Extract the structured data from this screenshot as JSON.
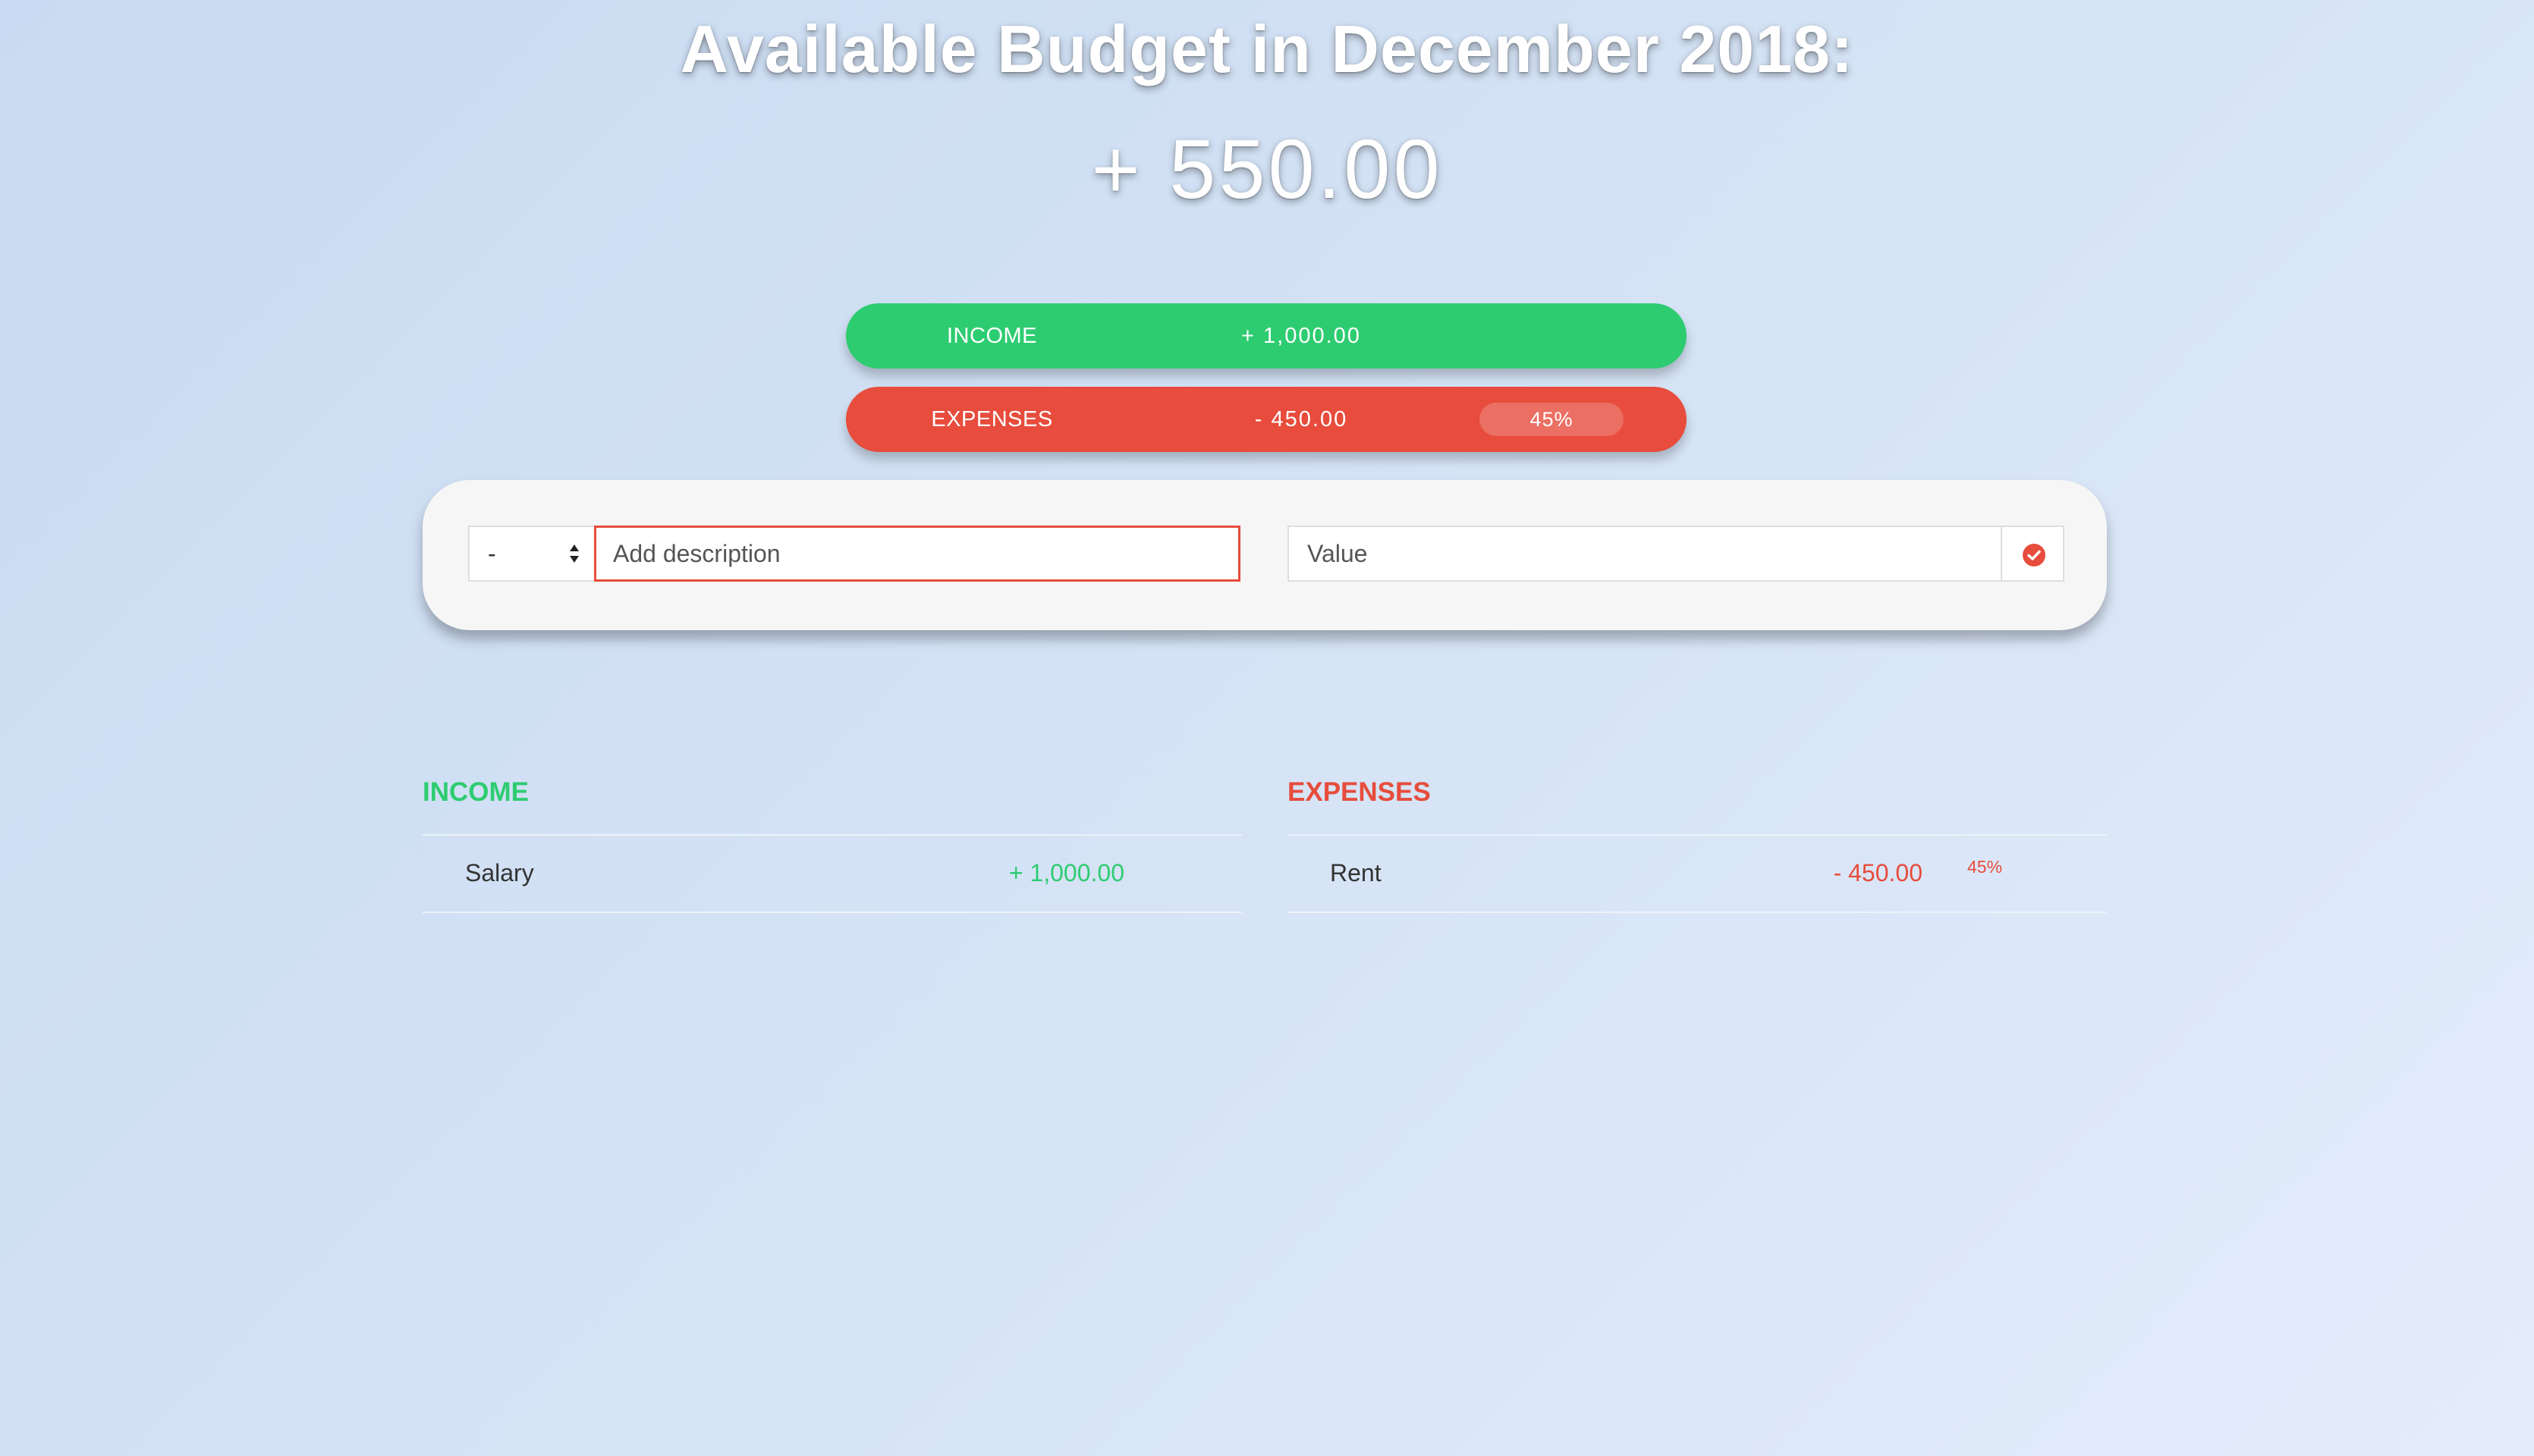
{
  "header": {
    "title": "Available Budget in December 2018:",
    "budget": "+ 550.00"
  },
  "summary": {
    "income": {
      "label": "INCOME",
      "value": "+ 1,000.00",
      "color": "#2ecc71"
    },
    "expenses": {
      "label": "EXPENSES",
      "value": "- 450.00",
      "percentage": "45%",
      "color": "#e74c3c"
    }
  },
  "add_form": {
    "type_select": {
      "selected": "-",
      "icon": "sort-arrows-icon"
    },
    "description": {
      "placeholder": "Add description",
      "value": ""
    },
    "value": {
      "placeholder": "Value",
      "value": ""
    },
    "submit": {
      "icon": "check-circle-icon",
      "color": "#e74c3c"
    }
  },
  "lists": {
    "income": {
      "title": "INCOME",
      "color": "#2ecc71",
      "items": [
        {
          "description": "Salary",
          "value": "+ 1,000.00"
        }
      ]
    },
    "expenses": {
      "title": "EXPENSES",
      "color": "#e74c3c",
      "items": [
        {
          "description": "Rent",
          "value": "- 450.00",
          "percentage": "45%"
        }
      ]
    }
  }
}
